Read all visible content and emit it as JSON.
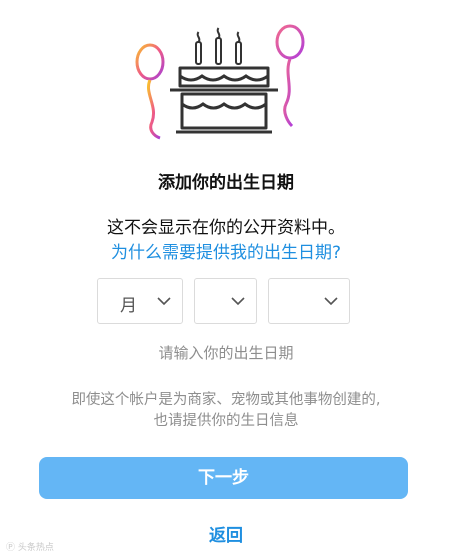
{
  "header": {
    "title": "添加你的出生日期"
  },
  "intro": {
    "notice": "这不会显示在你的公开资料中。",
    "why_link": "为什么需要提供我的出生日期?"
  },
  "birthday": {
    "month": {
      "selected": "月"
    },
    "day": {
      "selected": ""
    },
    "year": {
      "selected": ""
    },
    "hint": "请输入你的出生日期"
  },
  "note": {
    "line1": "即使这个帐户是为商家、宠物或其他事物创建的,",
    "line2": "也请提供你的生日信息"
  },
  "actions": {
    "next_label": "下一步",
    "back_label": "返回"
  },
  "watermark": "Ⓟ 头条热点",
  "icons": {
    "illustration": "birthday-cake-with-balloons-icon",
    "chevron": "chevron-down-icon"
  },
  "colors": {
    "link": "#1f8fe0",
    "button": "#64b6f5",
    "muted_text": "#8e8e8e",
    "border": "#dbdbdb"
  }
}
